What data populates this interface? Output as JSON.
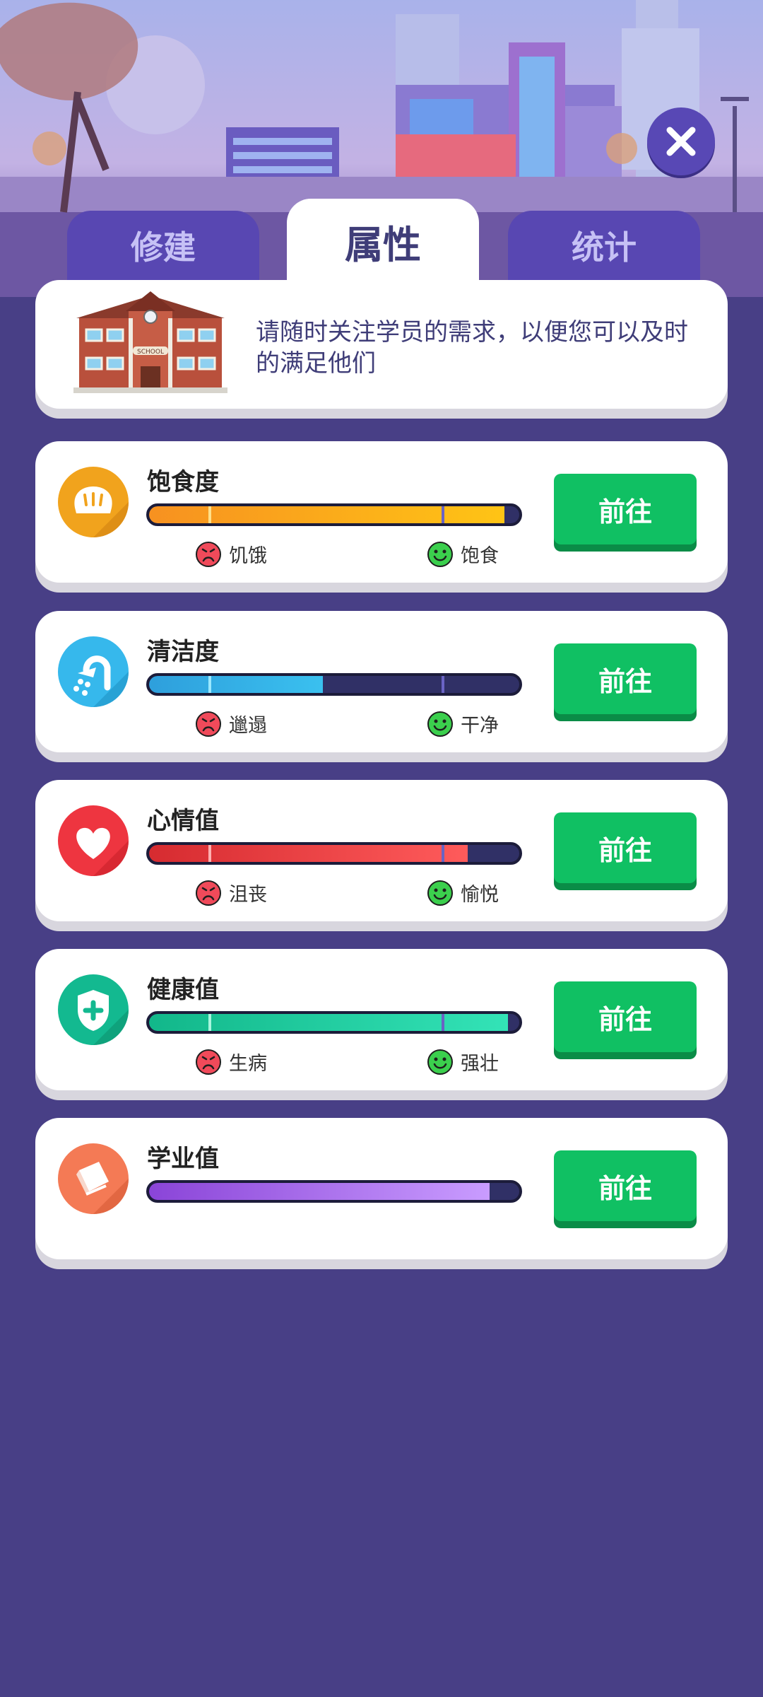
{
  "tabs": {
    "build": "修建",
    "attributes": "属性",
    "stats": "统计"
  },
  "intro": {
    "text": "请随时关注学员的需求，以便您可以及时的满足他们",
    "school_sign": "SCHOOL"
  },
  "attributes": [
    {
      "name": "饱食度",
      "icon": "bread-icon",
      "low_label": "饥饿",
      "high_label": "饱食",
      "level": 0.96,
      "button": "前往",
      "color": "#f8a21c"
    },
    {
      "name": "清洁度",
      "icon": "shower-icon",
      "low_label": "邋遢",
      "high_label": "干净",
      "level": 0.47,
      "button": "前往",
      "color": "#2fa9dc"
    },
    {
      "name": "心情值",
      "icon": "heart-icon",
      "low_label": "沮丧",
      "high_label": "愉悦",
      "level": 0.86,
      "button": "前往",
      "color": "#e8353c"
    },
    {
      "name": "健康值",
      "icon": "shield-plus-icon",
      "low_label": "生病",
      "high_label": "强壮",
      "level": 0.97,
      "button": "前往",
      "color": "#17c39a"
    },
    {
      "name": "学业值",
      "icon": "book-icon",
      "low_label": "",
      "high_label": "",
      "level": 0.92,
      "button": "前往",
      "color": "#a66cf0"
    }
  ],
  "colors": {
    "background": "#483f86",
    "tab_inactive": "#5847b2",
    "go_button": "#10c063"
  }
}
